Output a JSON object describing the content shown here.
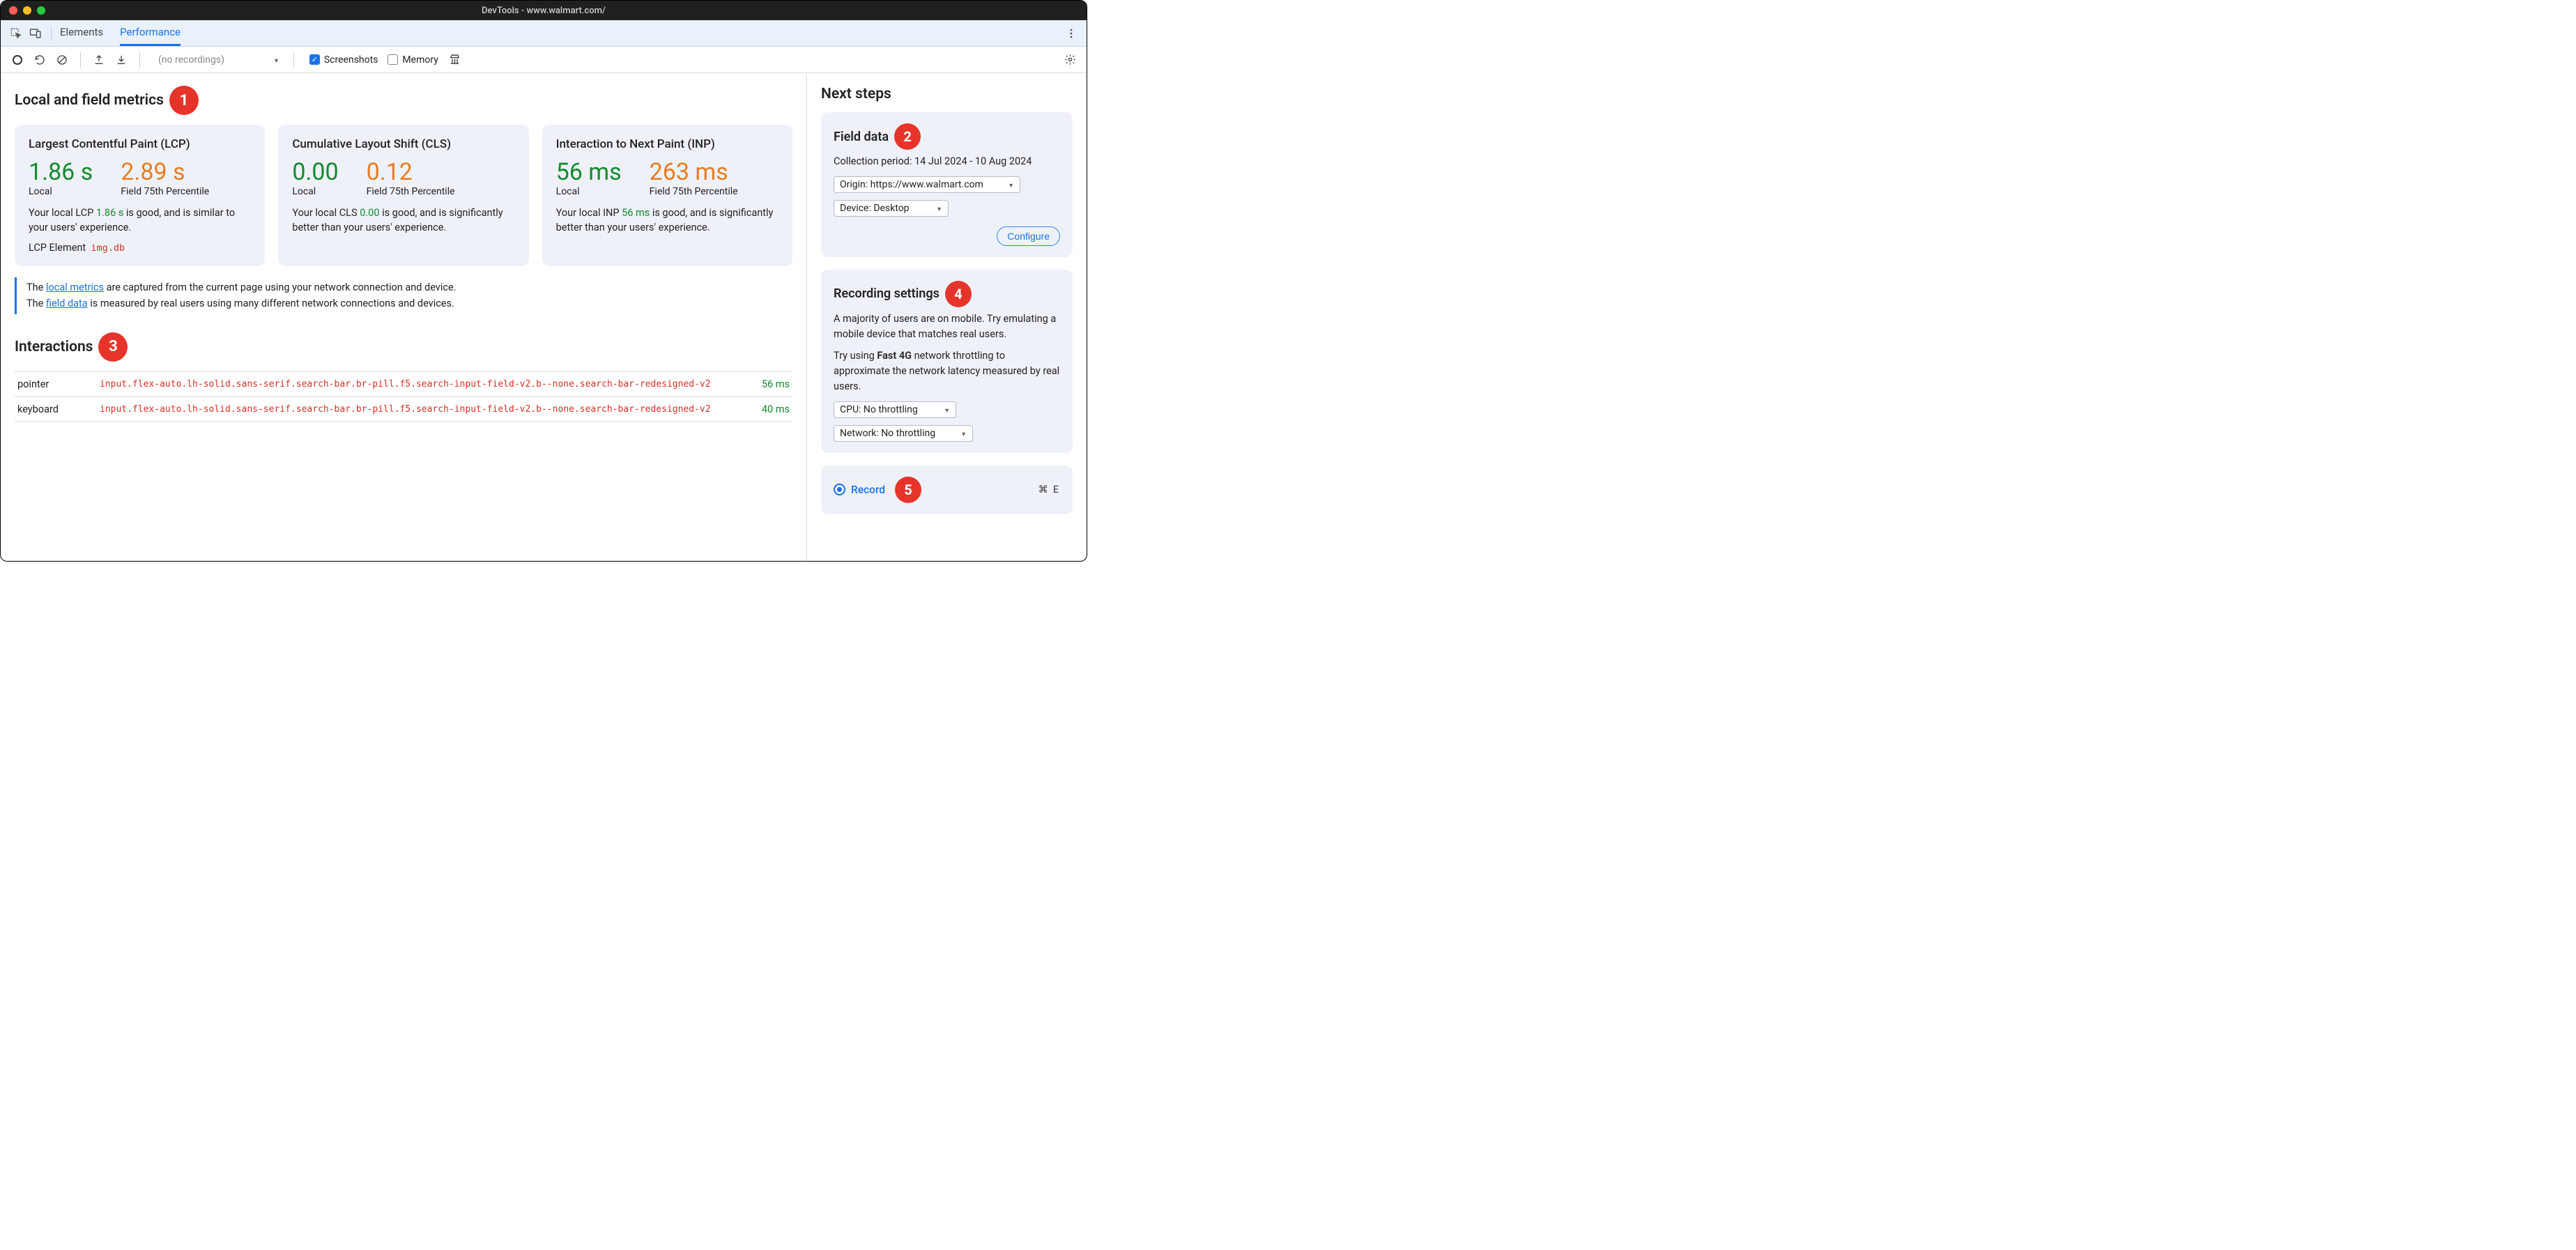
{
  "window": {
    "title": "DevTools - www.walmart.com/"
  },
  "tabs": {
    "elements": "Elements",
    "performance": "Performance"
  },
  "toolbar": {
    "recordings_placeholder": "(no recordings)",
    "screenshots_label": "Screenshots",
    "memory_label": "Memory"
  },
  "metrics": {
    "heading": "Local and field metrics",
    "cards": [
      {
        "title": "Largest Contentful Paint (LCP)",
        "local_value": "1.86 s",
        "field_value": "2.89 s",
        "local_label": "Local",
        "field_label": "Field 75th Percentile",
        "desc_pre": "Your local LCP ",
        "desc_val": "1.86 s",
        "desc_post": " is good, and is similar to your users' experience.",
        "lcp_elem_label": "LCP Element",
        "lcp_elem_value": "img.db"
      },
      {
        "title": "Cumulative Layout Shift (CLS)",
        "local_value": "0.00",
        "field_value": "0.12",
        "local_label": "Local",
        "field_label": "Field 75th Percentile",
        "desc_pre": "Your local CLS ",
        "desc_val": "0.00",
        "desc_post": " is good, and is significantly better than your users' experience."
      },
      {
        "title": "Interaction to Next Paint (INP)",
        "local_value": "56 ms",
        "field_value": "263 ms",
        "local_label": "Local",
        "field_label": "Field 75th Percentile",
        "desc_pre": "Your local INP ",
        "desc_val": "56 ms",
        "desc_post": " is good, and is significantly better than your users' experience."
      }
    ],
    "info": {
      "pre1": "The ",
      "link1": "local metrics",
      "post1": " are captured from the current page using your network connection and device.",
      "pre2": "The ",
      "link2": "field data",
      "post2": " is measured by real users using many different network connections and devices."
    }
  },
  "interactions": {
    "heading": "Interactions",
    "rows": [
      {
        "type": "pointer",
        "target": "input.flex-auto.lh-solid.sans-serif.search-bar.br-pill.f5.search-input-field-v2.b--none.search-bar-redesigned-v2",
        "time": "56 ms"
      },
      {
        "type": "keyboard",
        "target": "input.flex-auto.lh-solid.sans-serif.search-bar.br-pill.f5.search-input-field-v2.b--none.search-bar-redesigned-v2",
        "time": "40 ms"
      }
    ]
  },
  "sidebar": {
    "heading": "Next steps",
    "field_data": {
      "title": "Field data",
      "period_label": "Collection period: 14 Jul 2024 - 10 Aug 2024",
      "origin_select": "Origin: https://www.walmart.com",
      "device_select": "Device: Desktop",
      "configure": "Configure"
    },
    "recording_settings": {
      "title": "Recording settings",
      "p1": "A majority of users are on mobile. Try emulating a mobile device that matches real users.",
      "p2_pre": "Try using ",
      "p2_bold": "Fast 4G",
      "p2_post": " network throttling to approximate the network latency measured by real users.",
      "cpu_select": "CPU: No throttling",
      "network_select": "Network: No throttling"
    },
    "record": {
      "label": "Record",
      "shortcut": "⌘ E"
    }
  },
  "badges": {
    "b1": "1",
    "b2": "2",
    "b3": "3",
    "b4": "4",
    "b5": "5"
  }
}
